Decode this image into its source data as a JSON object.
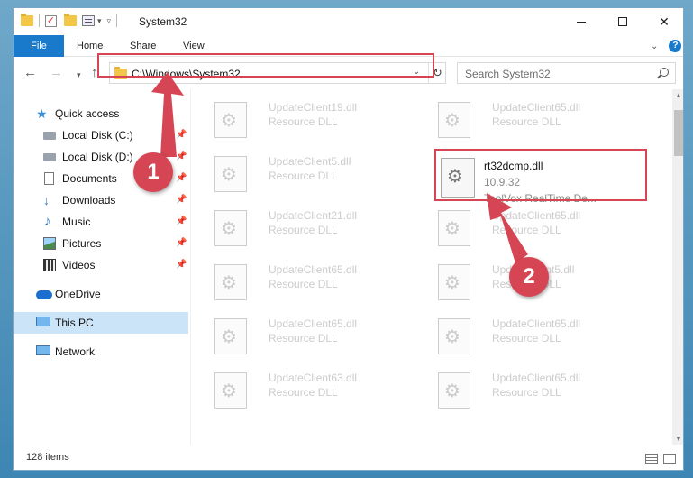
{
  "window": {
    "title": "System32",
    "controls": {
      "minimize": "",
      "maximize": "",
      "close": "✕"
    }
  },
  "ribbon": {
    "tabs": [
      "File",
      "Home",
      "Share",
      "View"
    ]
  },
  "address": {
    "path": "C:\\Windows\\System32",
    "search_placeholder": "Search System32"
  },
  "sidebar": {
    "items": [
      {
        "label": "Quick access",
        "icon": "star-icon"
      },
      {
        "label": "Local Disk (C:)",
        "icon": "disk-icon",
        "pinned": true
      },
      {
        "label": "Local Disk (D:)",
        "icon": "disk-icon",
        "pinned": true
      },
      {
        "label": "Documents",
        "icon": "document-icon",
        "pinned": true
      },
      {
        "label": "Downloads",
        "icon": "download-icon",
        "pinned": true
      },
      {
        "label": "Music",
        "icon": "music-icon",
        "pinned": true
      },
      {
        "label": "Pictures",
        "icon": "picture-icon",
        "pinned": true
      },
      {
        "label": "Videos",
        "icon": "video-icon",
        "pinned": true
      },
      {
        "label": "OneDrive",
        "icon": "cloud-icon"
      },
      {
        "label": "This PC",
        "icon": "computer-icon",
        "selected": true
      },
      {
        "label": "Network",
        "icon": "network-icon"
      }
    ]
  },
  "files": {
    "left": [
      {
        "name": "UpdateClient19.dll",
        "type": "Resource DLL"
      },
      {
        "name": "UpdateClient5.dll",
        "type": "Resource DLL"
      },
      {
        "name": "UpdateClient21.dll",
        "type": "Resource DLL"
      },
      {
        "name": "UpdateClient65.dll",
        "type": "Resource DLL"
      },
      {
        "name": "UpdateClient65.dll",
        "type": "Resource DLL"
      },
      {
        "name": "UpdateClient63.dll",
        "type": "Resource DLL"
      }
    ],
    "right": [
      {
        "name": "UpdateClient65.dll",
        "type": "Resource DLL"
      },
      {
        "name": "UpdateClient65.dll",
        "type": "Resource DLL"
      },
      {
        "name": "UpdateClient5.dll",
        "type": "Resource DLL"
      },
      {
        "name": "UpdateClient65.dll",
        "type": "Resource DLL"
      },
      {
        "name": "UpdateClient65.dll",
        "type": "Resource DLL"
      }
    ],
    "featured": {
      "name": "rt32dcmp.dll",
      "version": "10.9.32",
      "description": "ToolVox RealTime De..."
    }
  },
  "status": {
    "item_count": "128 items"
  },
  "annotations": {
    "badge1": "1",
    "badge2": "2",
    "color": "#d64553"
  },
  "colors": {
    "accent": "#1979ca",
    "selected_bg": "#cce4f7",
    "highlight": "#d64553"
  }
}
